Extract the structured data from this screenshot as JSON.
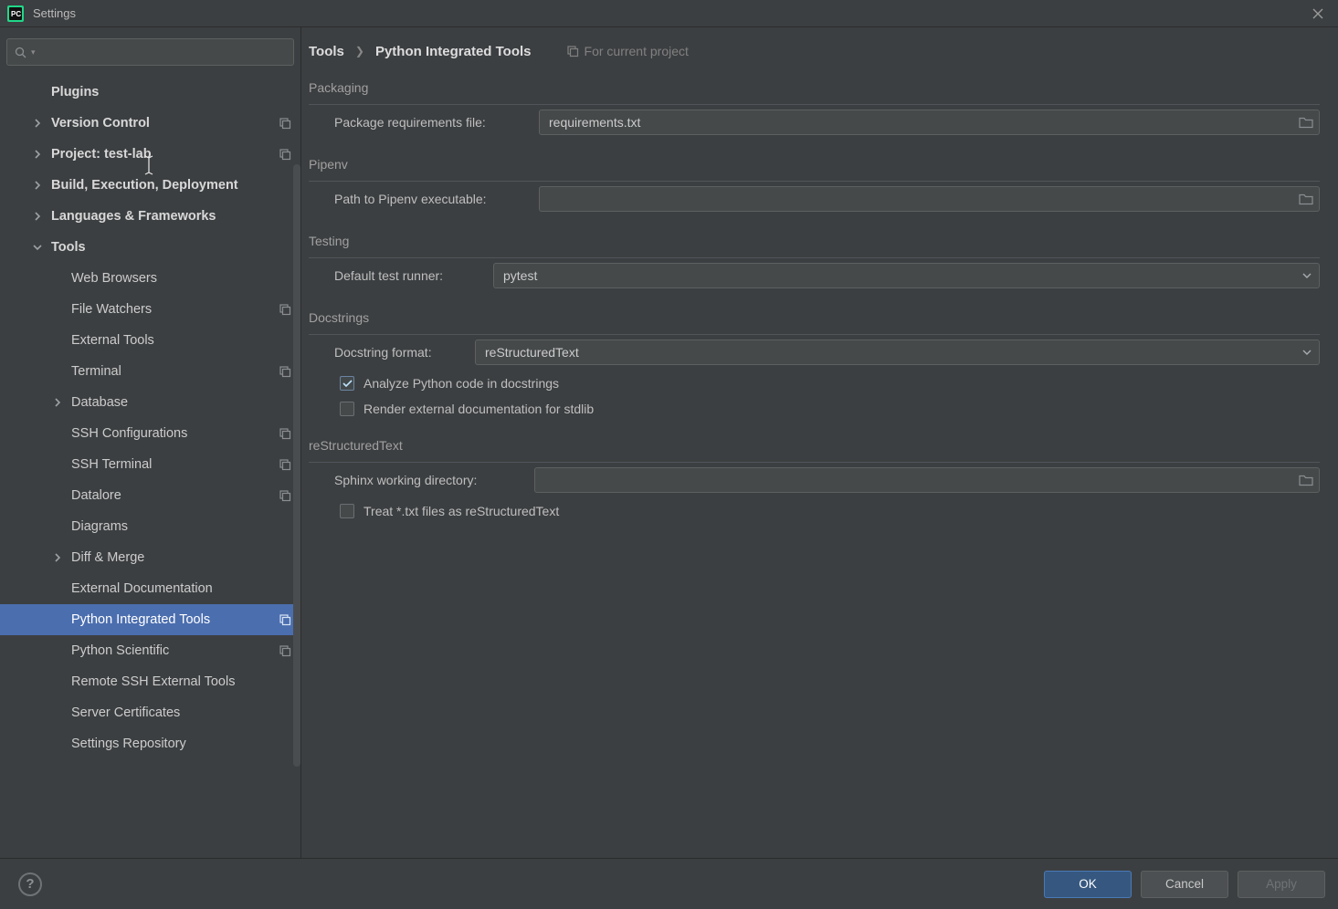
{
  "window": {
    "title": "Settings"
  },
  "search": {
    "placeholder": ""
  },
  "sidebar": {
    "items": [
      {
        "label": "Plugins",
        "indent": 1,
        "bold": true
      },
      {
        "label": "Version Control",
        "indent": 1,
        "bold": true,
        "arrow": "right",
        "proj": true
      },
      {
        "label": "Project: test-lab",
        "indent": 1,
        "bold": true,
        "arrow": "right",
        "proj": true
      },
      {
        "label": "Build, Execution, Deployment",
        "indent": 1,
        "bold": true,
        "arrow": "right"
      },
      {
        "label": "Languages & Frameworks",
        "indent": 1,
        "bold": true,
        "arrow": "right"
      },
      {
        "label": "Tools",
        "indent": 1,
        "bold": true,
        "arrow": "down"
      },
      {
        "label": "Web Browsers",
        "indent": 2
      },
      {
        "label": "File Watchers",
        "indent": 2,
        "proj": true
      },
      {
        "label": "External Tools",
        "indent": 2
      },
      {
        "label": "Terminal",
        "indent": 2,
        "proj": true
      },
      {
        "label": "Database",
        "indent": 2,
        "arrow": "right"
      },
      {
        "label": "SSH Configurations",
        "indent": 2,
        "proj": true
      },
      {
        "label": "SSH Terminal",
        "indent": 2,
        "proj": true
      },
      {
        "label": "Datalore",
        "indent": 2,
        "proj": true
      },
      {
        "label": "Diagrams",
        "indent": 2
      },
      {
        "label": "Diff & Merge",
        "indent": 2,
        "arrow": "right"
      },
      {
        "label": "External Documentation",
        "indent": 2
      },
      {
        "label": "Python Integrated Tools",
        "indent": 2,
        "selected": true,
        "proj": true
      },
      {
        "label": "Python Scientific",
        "indent": 2,
        "proj": true
      },
      {
        "label": "Remote SSH External Tools",
        "indent": 2
      },
      {
        "label": "Server Certificates",
        "indent": 2
      },
      {
        "label": "Settings Repository",
        "indent": 2
      }
    ]
  },
  "breadcrumb": {
    "root": "Tools",
    "leaf": "Python Integrated Tools",
    "scope": "For current project"
  },
  "sections": {
    "packaging": {
      "legend": "Packaging",
      "requirements_label": "Package requirements file:",
      "requirements_value": "requirements.txt"
    },
    "pipenv": {
      "legend": "Pipenv",
      "path_label": "Path to Pipenv executable:",
      "path_value": ""
    },
    "testing": {
      "legend": "Testing",
      "runner_label": "Default test runner:",
      "runner_value": "pytest"
    },
    "docstrings": {
      "legend": "Docstrings",
      "format_label": "Docstring format:",
      "format_value": "reStructuredText",
      "analyze_label": "Analyze Python code in docstrings",
      "render_label": "Render external documentation for stdlib"
    },
    "rst": {
      "legend": "reStructuredText",
      "sphinx_label": "Sphinx working directory:",
      "sphinx_value": "",
      "treat_label": "Treat *.txt files as reStructuredText"
    }
  },
  "buttons": {
    "ok": "OK",
    "cancel": "Cancel",
    "apply": "Apply"
  }
}
